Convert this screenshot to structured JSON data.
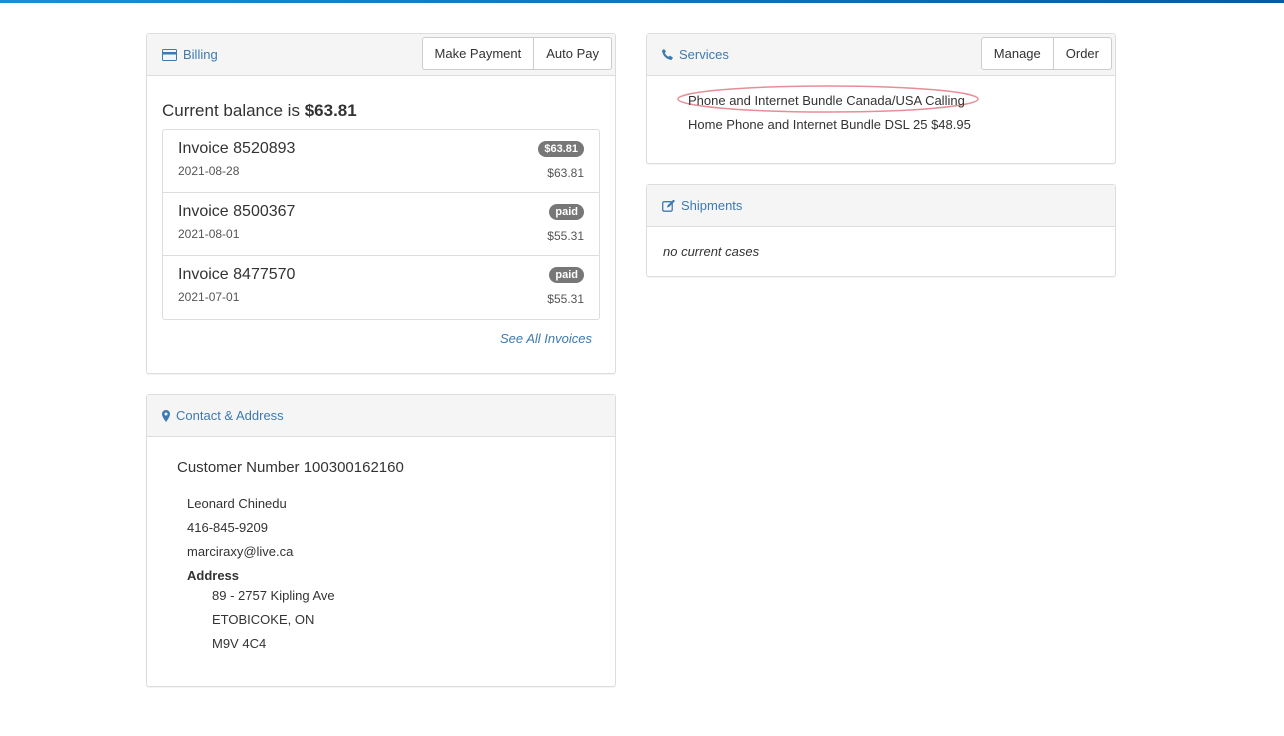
{
  "billing": {
    "title": "Billing",
    "make_payment": "Make Payment",
    "auto_pay": "Auto Pay",
    "balance_label": "Current balance is",
    "balance": "$63.81",
    "invoices": [
      {
        "name": "Invoice 8520893",
        "date": "2021-08-28",
        "badge": "$63.81",
        "amount": "$63.81"
      },
      {
        "name": "Invoice 8500367",
        "date": "2021-08-01",
        "badge": "paid",
        "amount": "$55.31"
      },
      {
        "name": "Invoice 8477570",
        "date": "2021-07-01",
        "badge": "paid",
        "amount": "$55.31"
      }
    ],
    "see_all": "See All Invoices"
  },
  "contact": {
    "title": "Contact & Address",
    "customer_number": "Customer Number 100300162160",
    "name": "Leonard Chinedu",
    "phone": "416-845-9209",
    "email": "marciraxy@live.ca",
    "address_label": "Address",
    "address": [
      "89 - 2757 Kipling Ave",
      "ETOBICOKE, ON",
      "M9V 4C4"
    ]
  },
  "services": {
    "title": "Services",
    "manage": "Manage",
    "order": "Order",
    "items": [
      "Phone and Internet Bundle Canada/USA Calling",
      "Home Phone and Internet Bundle DSL 25 $48.95"
    ]
  },
  "shipments": {
    "title": "Shipments",
    "empty": "no current cases"
  },
  "colors": {
    "link": "#3d7ab0",
    "badge": "#777777",
    "annotation": "#e0707a"
  }
}
